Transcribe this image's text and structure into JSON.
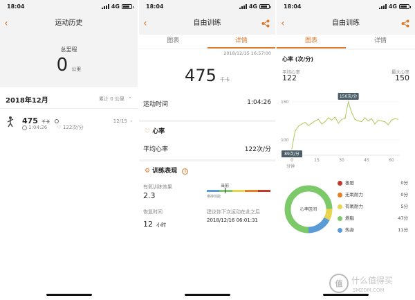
{
  "status": {
    "time": "18:04",
    "network": "4G"
  },
  "screen1": {
    "title": "运动历史",
    "total_label": "总里程",
    "total_value": "0",
    "total_unit": "公里",
    "month": "2018年12月",
    "month_total": "累计 0 公里",
    "record": {
      "calories": "475",
      "cal_unit": "千卡",
      "date": "12/15",
      "duration": "1:04:26",
      "heart_rate": "122次/分"
    }
  },
  "screen2": {
    "title": "自由训练",
    "tabs": [
      "图表",
      "详情"
    ],
    "timestamp": "2018/12/15 16:57:00",
    "calories": "475",
    "cal_unit": "千卡",
    "duration_label": "运动时间",
    "duration_value": "1:04:26",
    "hr_section": "心率",
    "avg_hr_label": "平均心率",
    "avg_hr_value": "122次/分",
    "perf_section": "训练表现",
    "aerobic_label": "有氧训练效果",
    "aerobic_value": "2.3",
    "scale_current": "当前",
    "scale_maintain": "维持体能",
    "recovery_label": "恢复时间",
    "recovery_value": "12",
    "recovery_unit": "小时",
    "next_label": "建议你下次运动在此之后",
    "next_value": "2018/12/16 06:01:31"
  },
  "screen3": {
    "title": "自由训练",
    "tabs": [
      "图表",
      "详情"
    ],
    "hr_title": "心率 (次/分)",
    "avg_label": "平均心率",
    "avg_value": "122",
    "max_label": "最大心率",
    "max_value": "150",
    "peak_label": "150次/分",
    "low_label": "89次/分",
    "y_ticks": [
      "150",
      "100"
    ],
    "x_ticks": [
      "0",
      "15",
      "30",
      "45",
      "60"
    ],
    "x_unit": "分钟",
    "donut_label": "心率区间",
    "zones": [
      {
        "name": "极限",
        "value": "0分",
        "color": "#c0392b"
      },
      {
        "name": "无氧耐力",
        "value": "0分",
        "color": "#e67e22"
      },
      {
        "name": "有氧耐力",
        "value": "5分",
        "color": "#e8d44d"
      },
      {
        "name": "燃脂",
        "value": "47分",
        "color": "#7cc96a"
      },
      {
        "name": "热身",
        "value": "11分",
        "color": "#5b9bd5"
      }
    ],
    "zone_minutes": [
      0,
      0,
      5,
      47,
      11
    ]
  },
  "chart_data": {
    "type": "line",
    "title": "心率 (次/分)",
    "xlabel": "分钟",
    "ylabel": "",
    "xlim": [
      0,
      65
    ],
    "ylim": [
      80,
      160
    ],
    "series": [
      {
        "x": [
          0,
          2,
          4,
          6,
          8,
          10,
          12,
          14,
          16,
          18,
          20,
          22,
          24,
          26,
          28,
          30,
          32,
          34,
          36,
          38,
          40,
          42,
          44,
          46,
          48,
          50,
          52,
          54,
          56,
          58,
          60,
          62,
          64
        ],
        "values": [
          89,
          112,
          118,
          121,
          123,
          119,
          122,
          125,
          127,
          121,
          124,
          129,
          126,
          130,
          122,
          127,
          128,
          150,
          136,
          127,
          125,
          124,
          129,
          125,
          128,
          121,
          126,
          125,
          124,
          120,
          126,
          128,
          127
        ]
      }
    ]
  },
  "watermark": {
    "text": "什么值得买",
    "sub": "SMZDM.COM"
  }
}
